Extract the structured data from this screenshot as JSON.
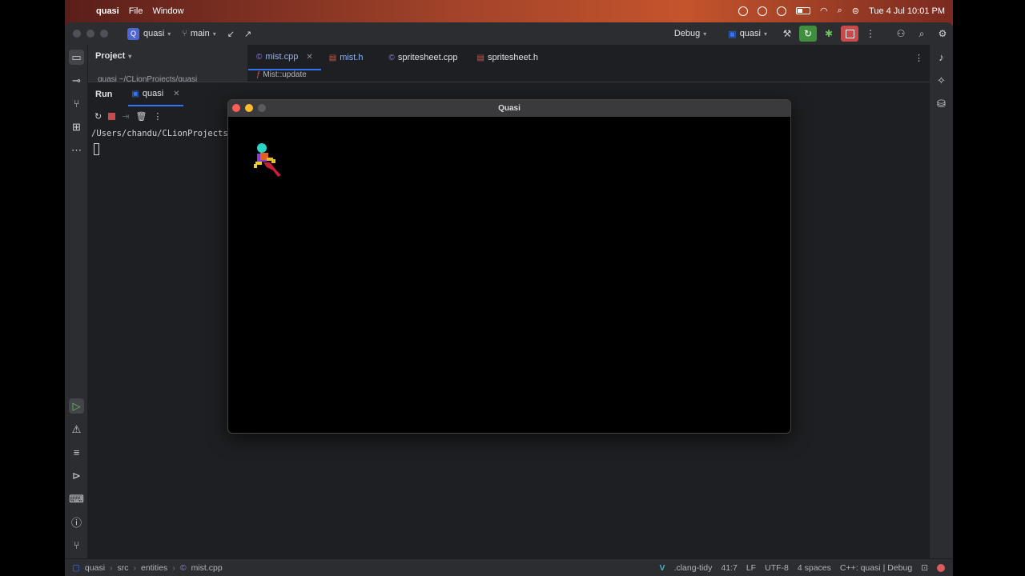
{
  "menubar": {
    "app": "quasi",
    "items": [
      "File",
      "Window"
    ],
    "clock": "Tue 4 Jul  10:01 PM"
  },
  "titlebar": {
    "project_badge": "Q",
    "project": "quasi",
    "branch": "main",
    "config": "Debug",
    "run_target": "quasi"
  },
  "project_panel": {
    "title": "Project",
    "root": "quasi  ~/CLionProjects/quasi"
  },
  "tabs": [
    {
      "label": "mist.cpp",
      "kind": "cpp",
      "active": true
    },
    {
      "label": "mist.h",
      "kind": "h",
      "active": false
    },
    {
      "label": "spritesheet.cpp",
      "kind": "cpp",
      "active": false
    },
    {
      "label": "spritesheet.h",
      "kind": "h",
      "active": false
    }
  ],
  "editor": {
    "breadcrumb": "Mist::update"
  },
  "run": {
    "title": "Run",
    "tab": "quasi",
    "console_line": "/Users/chandu/CLionProjects/q"
  },
  "app_window": {
    "title": "Quasi"
  },
  "status": {
    "path": [
      "quasi",
      "src",
      "entities",
      "mist.cpp"
    ],
    "linter": ".clang-tidy",
    "position": "41:7",
    "line_ending": "LF",
    "encoding": "UTF-8",
    "indent": "4 spaces",
    "context": "C++: quasi | Debug"
  },
  "colors": {
    "accent": "#3574f0",
    "ide_bg": "#1e1f22",
    "panel_bg": "#2b2d30",
    "run_green": "#3f8f3f",
    "stop_red": "#c94a4a"
  }
}
